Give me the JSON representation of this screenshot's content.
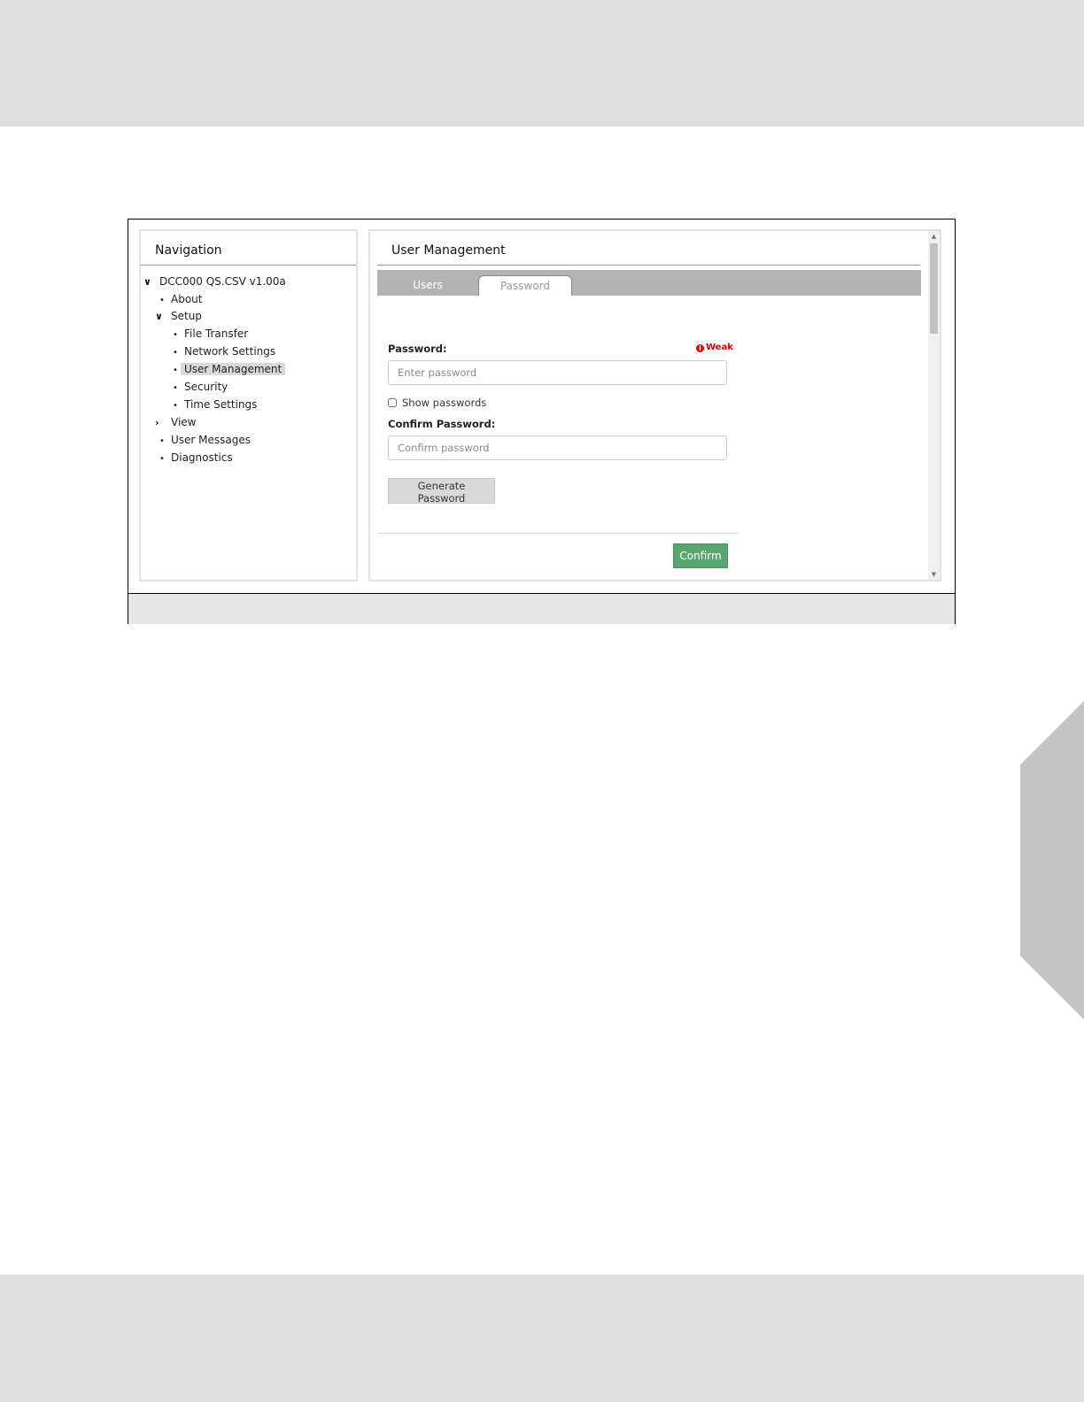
{
  "colors": {
    "band": "#dfdedf",
    "accent_green": "#5aa66f",
    "weak_red": "#e00000",
    "tab_strip": "#b3b3b3"
  },
  "navigation": {
    "title": "Navigation",
    "items": [
      {
        "label": "DCC000 QS.CSV v1.00a",
        "icon": "chevron-down-icon"
      },
      {
        "label": "About",
        "icon": "bullet-icon"
      },
      {
        "label": "Setup",
        "icon": "chevron-down-icon"
      },
      {
        "label": "File Transfer",
        "icon": "bullet-icon"
      },
      {
        "label": "Network Settings",
        "icon": "bullet-icon"
      },
      {
        "label": "User Management",
        "icon": "bullet-icon",
        "selected": true
      },
      {
        "label": "Security",
        "icon": "bullet-icon"
      },
      {
        "label": "Time Settings",
        "icon": "bullet-icon"
      },
      {
        "label": "View",
        "icon": "chevron-right-icon"
      },
      {
        "label": "User Messages",
        "icon": "bullet-icon"
      },
      {
        "label": "Diagnostics",
        "icon": "bullet-icon"
      }
    ]
  },
  "content": {
    "title": "User Management",
    "tabs": [
      {
        "label": "Users",
        "active": false
      },
      {
        "label": "Password",
        "active": true
      }
    ],
    "password": {
      "label": "Password:",
      "placeholder": "Enter password",
      "strength": "Weak",
      "strength_icon": "info-circle-icon"
    },
    "show_passwords": {
      "label": "Show passwords",
      "checked": false
    },
    "confirm_password": {
      "label": "Confirm Password:",
      "placeholder": "Confirm password"
    },
    "generate_label": "Generate Password",
    "confirm_label": "Confirm"
  }
}
